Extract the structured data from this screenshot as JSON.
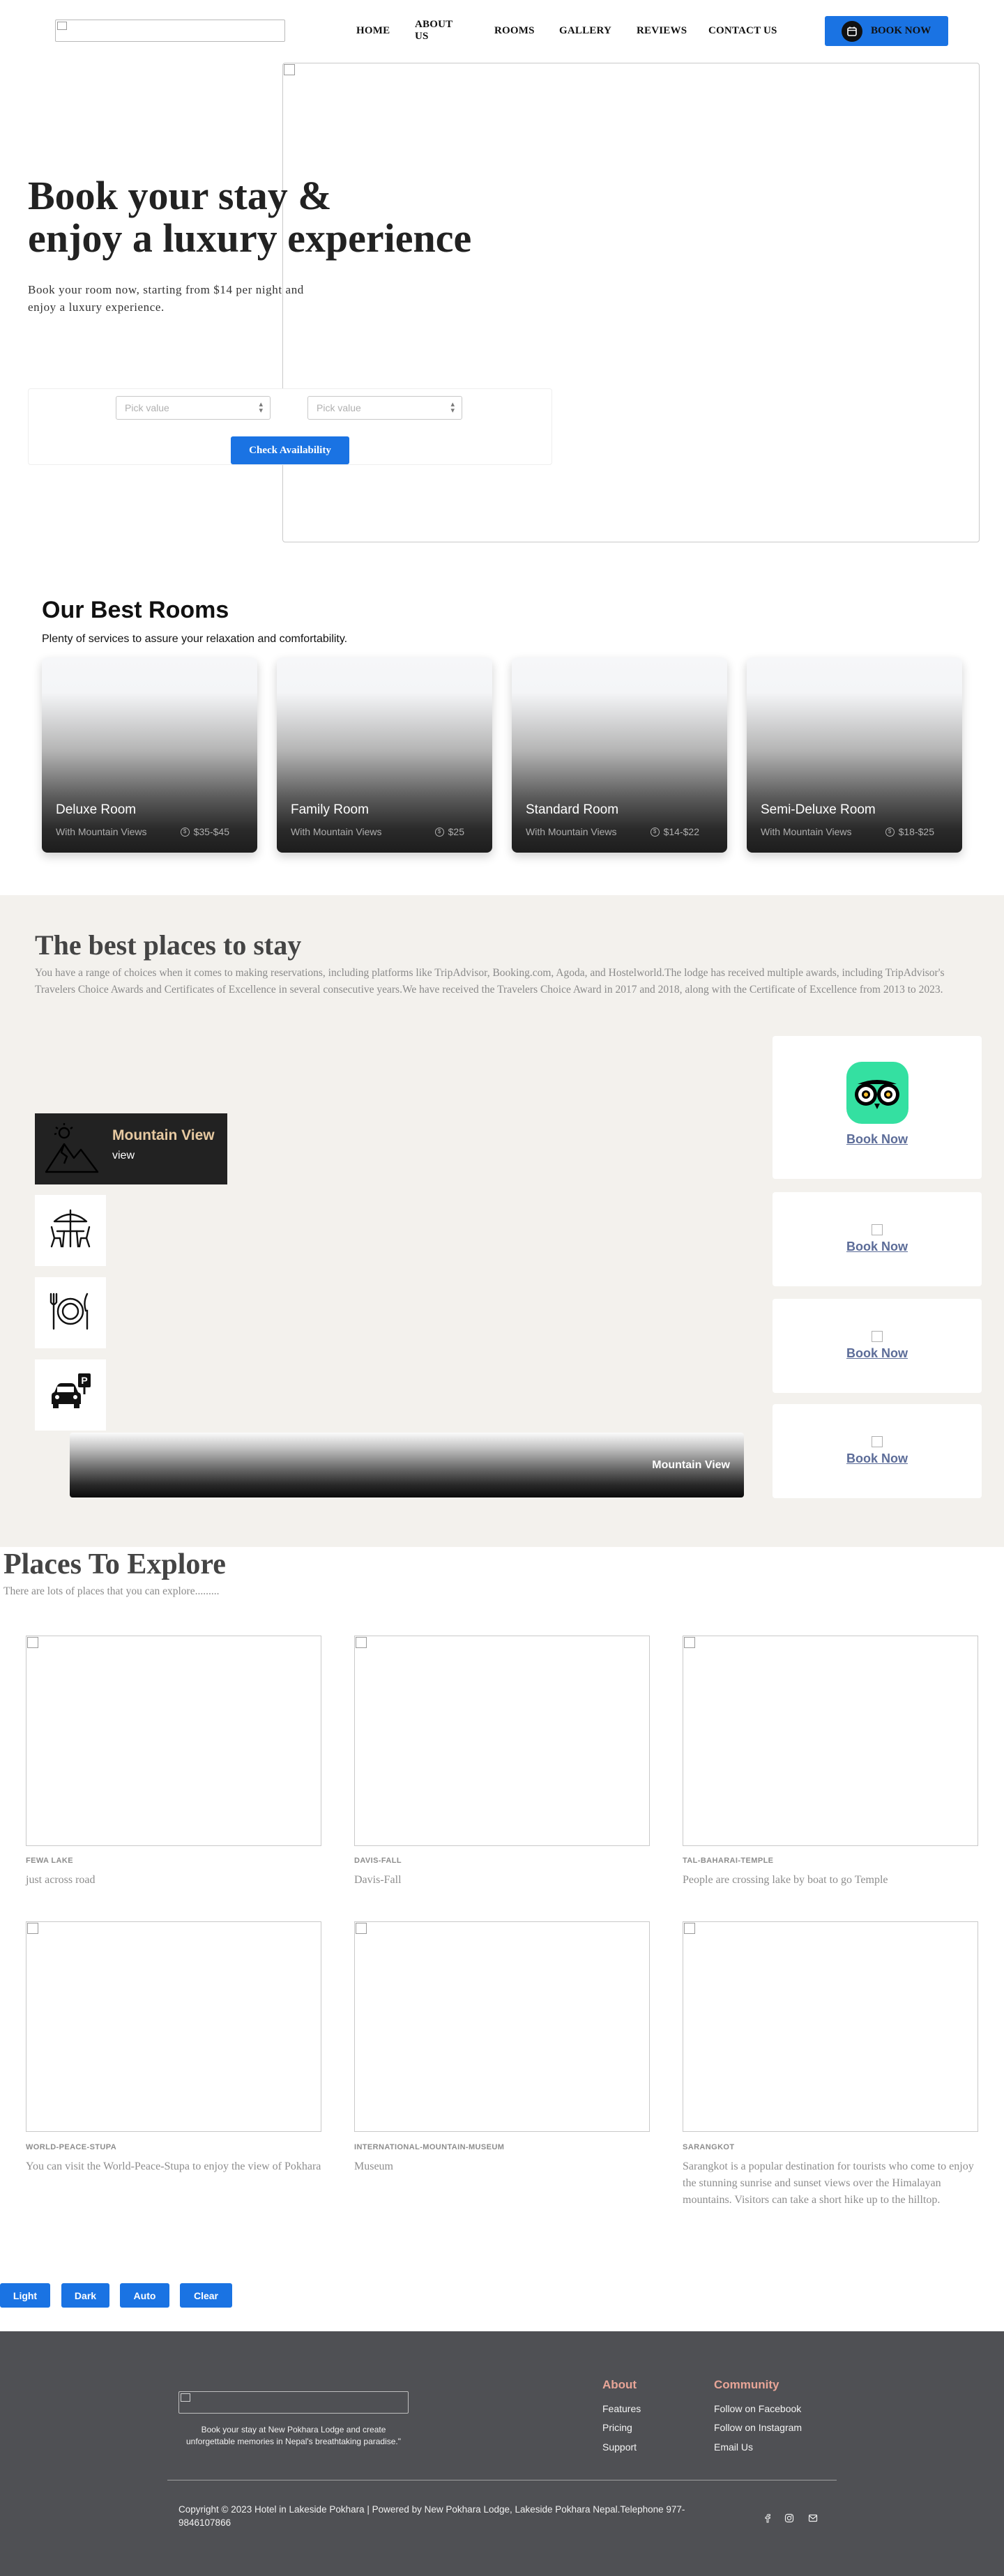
{
  "nav": {
    "items": [
      "HOME",
      "ABOUT US",
      "ROOMS",
      "GALLERY",
      "REVIEWS",
      "CONTACT US"
    ],
    "book_now": "BOOK NOW"
  },
  "hero": {
    "title_line1": "Book your stay &",
    "title_line2": "enjoy a luxury experience",
    "subtitle": "Book your room now, starting from $14 per night and enjoy a luxury experience.",
    "pick1_placeholder": "Pick value",
    "pick2_placeholder": "Pick value",
    "check_button": "Check Availability"
  },
  "rooms": {
    "title": "Our Best Rooms",
    "subtitle": "Plenty of services to assure your relaxation and comfortability.",
    "items": [
      {
        "name": "Deluxe Room",
        "view": "With Mountain Views",
        "price": "$35-$45"
      },
      {
        "name": "Family Room",
        "view": "With Mountain Views",
        "price": "$25"
      },
      {
        "name": "Standard Room",
        "view": "With Mountain Views",
        "price": "$14-$22"
      },
      {
        "name": "Semi-Deluxe Room",
        "view": "With Mountain Views",
        "price": "$18-$25"
      }
    ]
  },
  "best_places": {
    "title": "The best places to stay",
    "paragraph": "You have a range of choices when it comes to making reservations, including platforms like TripAdvisor, Booking.com, Agoda, and Hostelworld.The lodge has received multiple awards, including TripAdvisor's Travelers Choice Awards and Certificates of Excellence in several consecutive years.We have received the Travelers Choice Award in 2017 and 2018, along with the Certificate of Excellence from 2013 to 2023.",
    "feature_title": "Mountain View",
    "feature_sub": "view",
    "banner_label": "Mountain View",
    "book_links": [
      "Book Now",
      "Book Now",
      "Book Now",
      "Book Now"
    ]
  },
  "places": {
    "title": "Places To Explore",
    "subtitle": "There are lots of places that you can explore.........",
    "items": [
      {
        "caption": "FEWA LAKE",
        "desc": "just across road"
      },
      {
        "caption": "DAVIS-FALL",
        "desc": "Davis-Fall"
      },
      {
        "caption": "TAL-BAHARAI-TEMPLE",
        "desc": "People are crossing lake by boat to go Temple"
      },
      {
        "caption": "WORLD-PEACE-STUPA",
        "desc": "You can visit the World-Peace-Stupa to enjoy the view of Pokhara"
      },
      {
        "caption": "INTERNATIONAL-MOUNTAIN-MUSEUM",
        "desc": "Museum"
      },
      {
        "caption": "SARANGKOT",
        "desc": "Sarangkot is a popular destination for tourists who come to enjoy the stunning sunrise and sunset views over the Himalayan mountains. Visitors can take a short hike up to the hilltop."
      }
    ]
  },
  "theme_buttons": [
    "Light",
    "Dark",
    "Auto",
    "Clear"
  ],
  "footer": {
    "tagline": "Book your stay at New Pokhara Lodge and create unforgettable memories in Nepal's breathtaking paradise.\"",
    "about_head": "About",
    "about_links": [
      "Features",
      "Pricing",
      "Support"
    ],
    "community_head": "Community",
    "community_links": [
      "Follow on Facebook",
      "Follow on Instagram",
      "Email Us"
    ],
    "copyright": "Copyright © 2023 Hotel in Lakeside Pokhara | Powered by New Pokhara Lodge, Lakeside Pokhara Nepal.Telephone 977-9846107866",
    "social_icons": [
      "facebook-icon",
      "instagram-icon",
      "email-icon"
    ]
  },
  "colors": {
    "primary_blue": "#1a73e3",
    "section_bg": "#f3f1ed",
    "footer_bg": "#4f5054",
    "footer_heading": "#e8a597",
    "feature_gold": "#e7c9a1",
    "tripadvisor_green": "#34e0a1"
  }
}
